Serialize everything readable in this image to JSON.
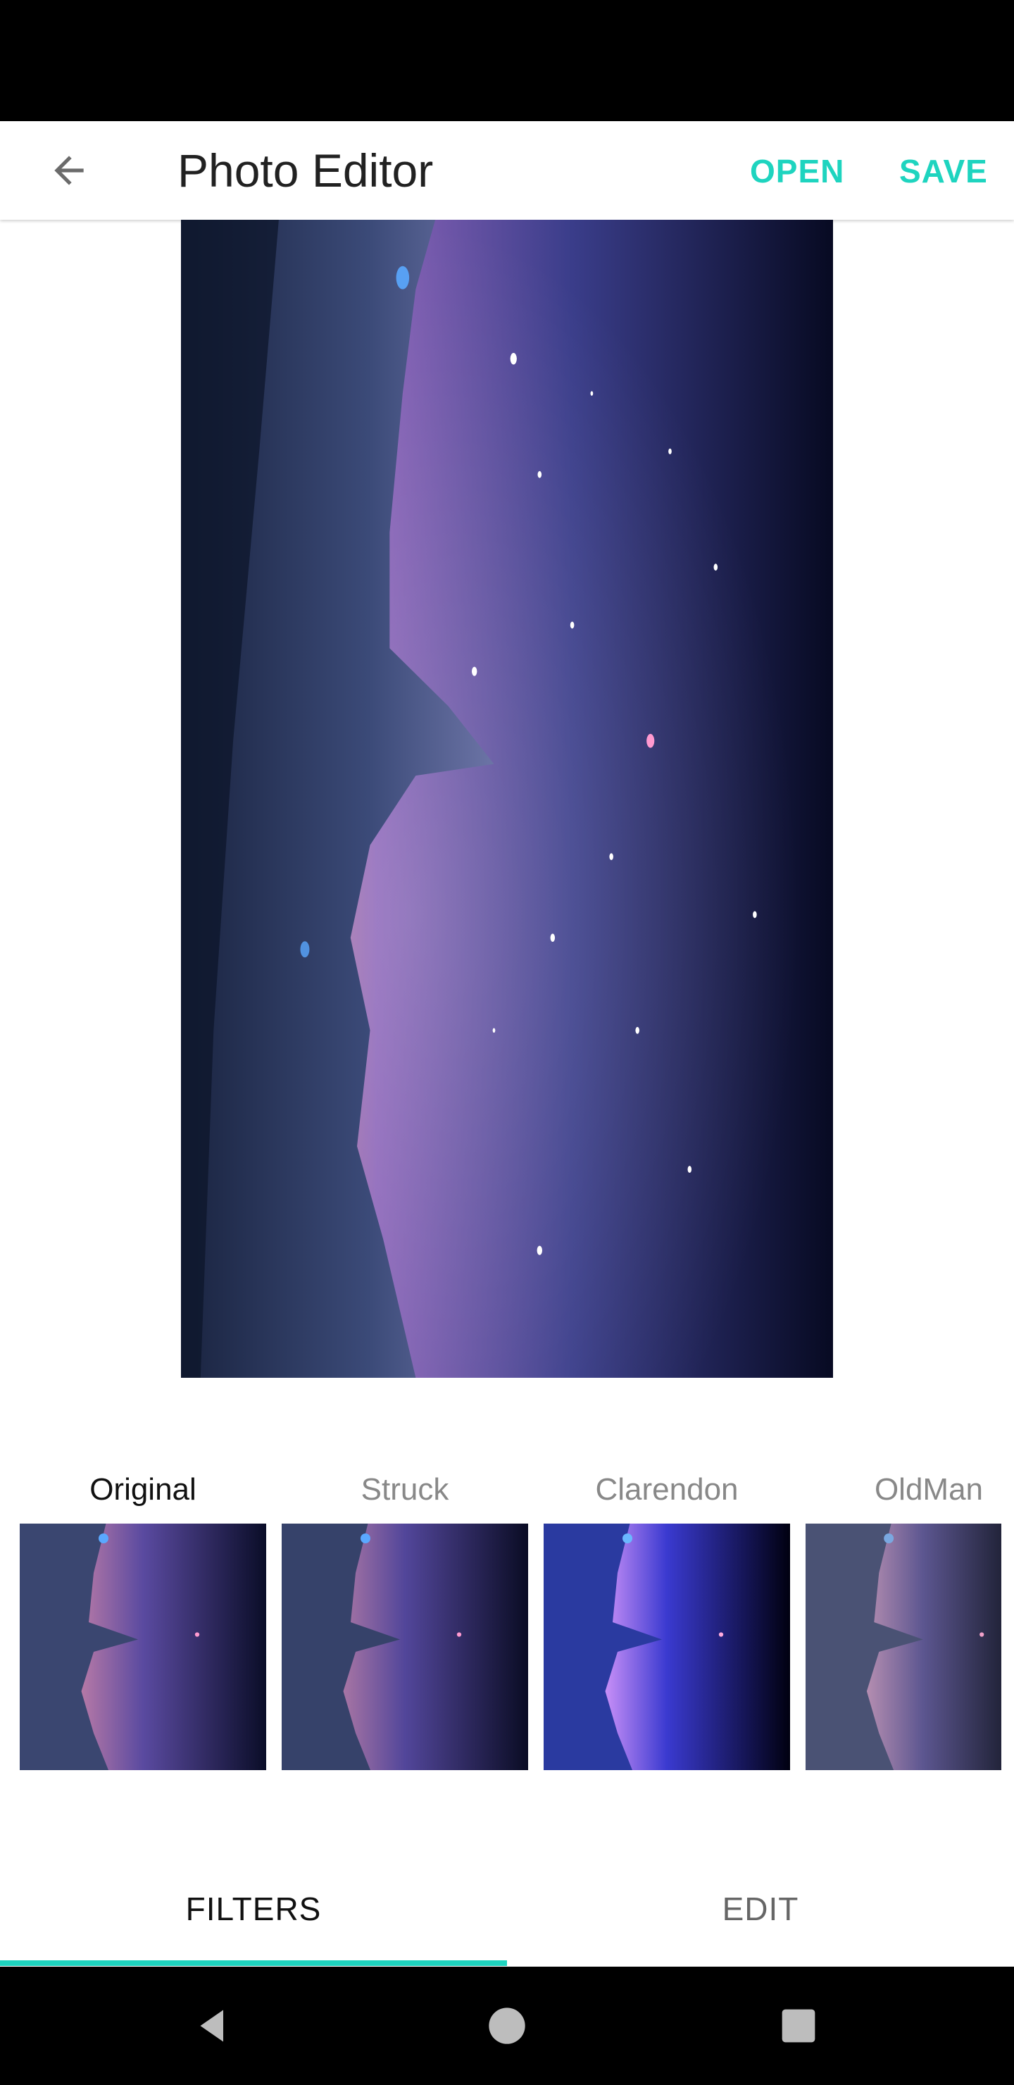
{
  "app_bar": {
    "title": "Photo Editor",
    "back_icon": "arrow-left-icon",
    "open_label": "OPEN",
    "save_label": "SAVE",
    "accent_color": "#1ed4bf"
  },
  "filters": [
    {
      "label": "Original",
      "selected": true
    },
    {
      "label": "Struck",
      "selected": false
    },
    {
      "label": "Clarendon",
      "selected": false
    },
    {
      "label": "OldMan",
      "selected": false
    }
  ],
  "tabs": {
    "filters_label": "FILTERS",
    "edit_label": "EDIT",
    "selected": "FILTERS"
  },
  "nav_bar": {
    "icons": [
      "nav-back-icon",
      "nav-home-icon",
      "nav-recents-icon"
    ]
  }
}
